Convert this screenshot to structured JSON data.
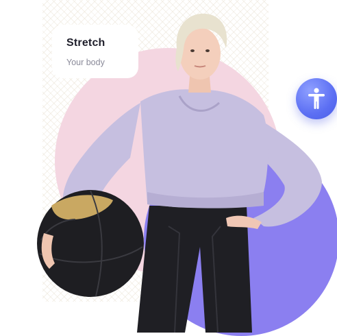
{
  "card": {
    "title": "Stretch",
    "subtitle": "Your body"
  },
  "badge": {
    "icon": "accessibility-icon",
    "color": "#5c6ff3"
  },
  "colors": {
    "pink_blob": "#f4d6e1",
    "purple_blob": "#8b7ff0",
    "hoodie": "#c6bfe0",
    "leggings": "#1f1f24"
  }
}
